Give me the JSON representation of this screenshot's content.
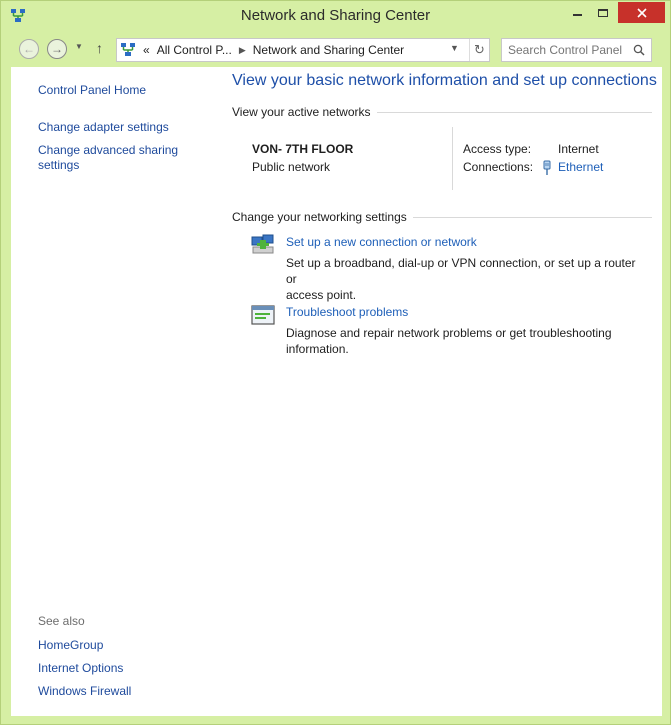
{
  "window": {
    "title": "Network and Sharing Center",
    "accent_color": "#d6efa4",
    "close_color": "#c7312a"
  },
  "navigation": {
    "back_icon": "back-arrow-icon",
    "forward_icon": "forward-arrow-icon",
    "up_icon": "up-arrow-icon"
  },
  "address_bar": {
    "overflow": "«",
    "crumbs": [
      "All Control P...",
      "Network and Sharing Center"
    ]
  },
  "search": {
    "placeholder": "Search Control Panel"
  },
  "left_nav": {
    "home": "Control Panel Home",
    "adapter": "Change adapter settings",
    "advanced_line1": "Change advanced sharing",
    "advanced_line2": "settings",
    "see_also": "See also",
    "homegroup": "HomeGroup",
    "internet_options": "Internet Options",
    "firewall": "Windows Firewall"
  },
  "main": {
    "heading": "View your basic network information and set up connections",
    "active_networks_label": "View your active networks",
    "network": {
      "name": "VON- 7TH FLOOR",
      "type": "Public network",
      "access_type_label": "Access type:",
      "access_type_value": "Internet",
      "connections_label": "Connections:",
      "connection_value": "Ethernet"
    },
    "change_settings_label": "Change your networking settings",
    "tasks": [
      {
        "link": "Set up a new connection or network",
        "desc_line1": "Set up a broadband, dial-up or VPN connection, or set up a router or",
        "desc_line2": "access point."
      },
      {
        "link": "Troubleshoot problems",
        "desc_line1": "Diagnose and repair network problems or get troubleshooting",
        "desc_line2": "information."
      }
    ]
  }
}
